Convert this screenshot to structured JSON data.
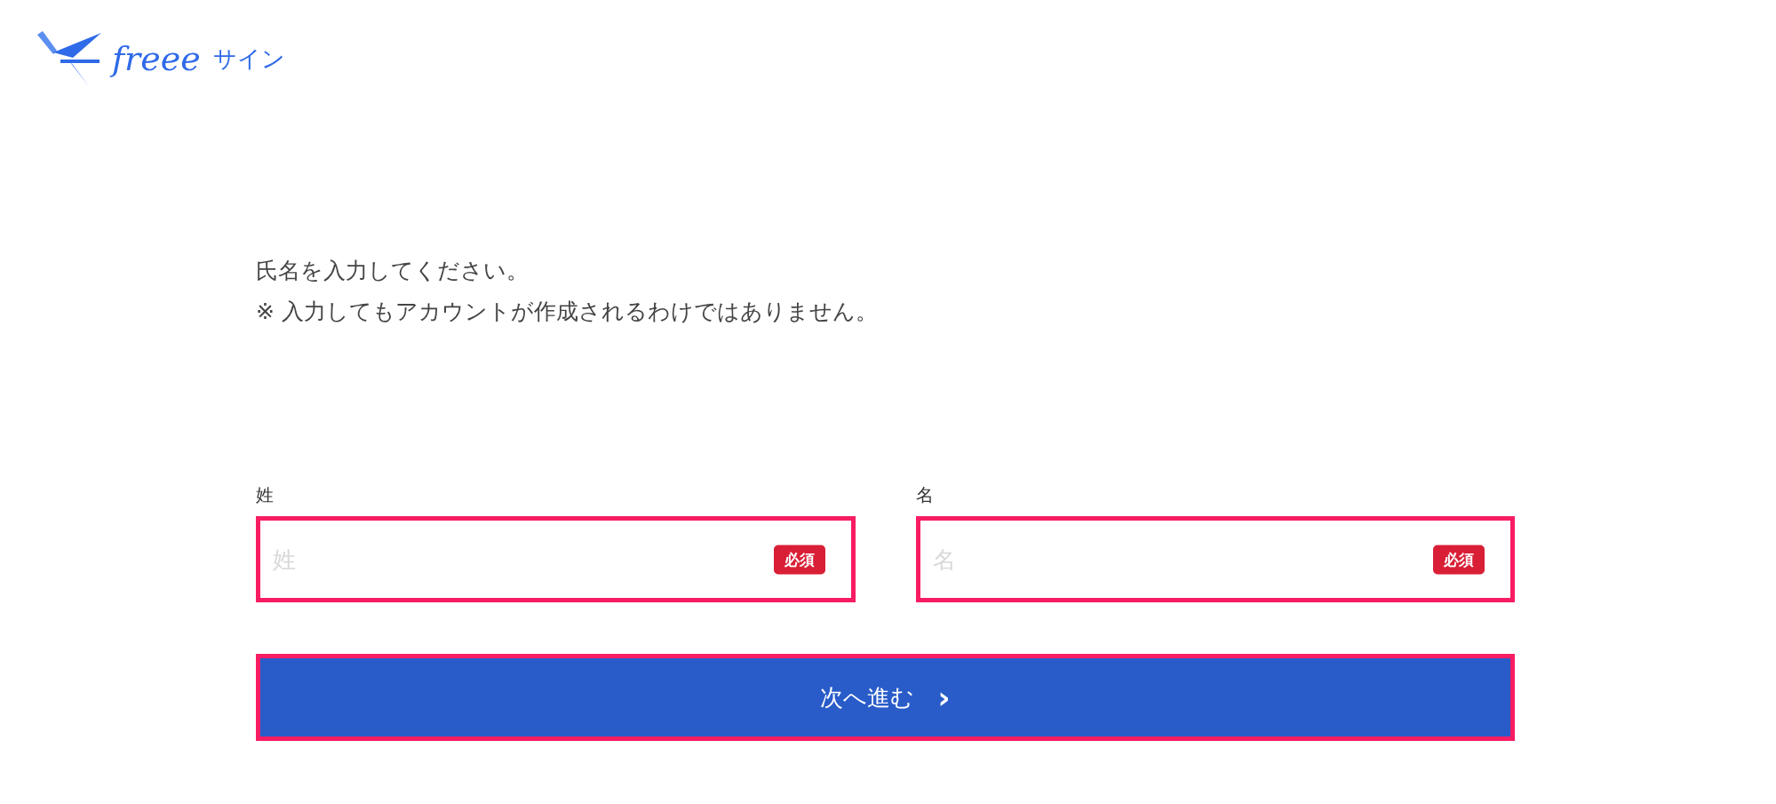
{
  "logo": {
    "wordmark": "freee",
    "product": "サイン"
  },
  "instructions": [
    "氏名を入力してください。",
    "※ 入力してもアカウントが作成されるわけではありません。"
  ],
  "fields": [
    {
      "label": "姓",
      "placeholder": "姓",
      "badge": "必須",
      "highlighted": true
    },
    {
      "label": "名",
      "placeholder": "名",
      "badge": "必須",
      "highlighted": true
    }
  ],
  "submit_button": {
    "label": "次へ進む",
    "icon": "›",
    "highlighted": true
  }
}
